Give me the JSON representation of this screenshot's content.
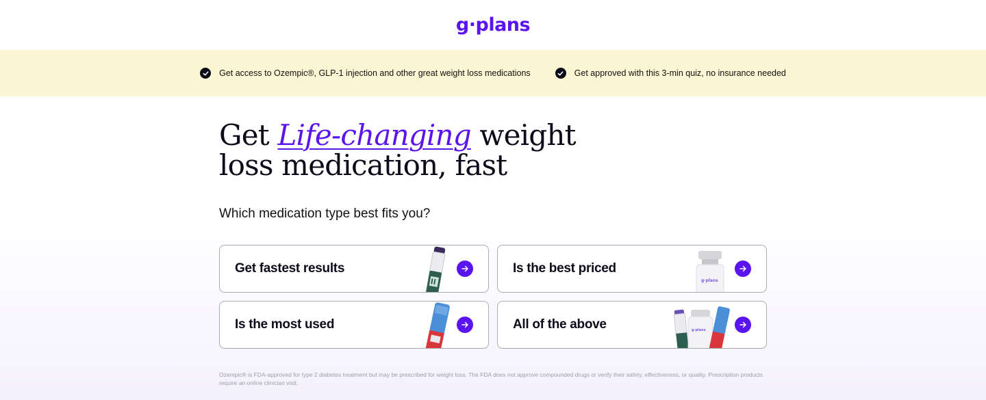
{
  "brand": {
    "logo_text": "g·plans",
    "accent_color": "#5a14f0"
  },
  "banner": {
    "items": [
      {
        "text": "Get access to Ozempic®, GLP-1 injection and other great weight loss medications",
        "icon": "check-circle-icon"
      },
      {
        "text": "Get approved with this 3-min quiz, no insurance needed",
        "icon": "check-circle-icon"
      }
    ]
  },
  "headline": {
    "prefix": "Get ",
    "accent": "Life-changing",
    "suffix": " weight loss medication, fast"
  },
  "question": "Which medication type best fits you?",
  "options": [
    {
      "label": "Get fastest results",
      "image": "injection-pen-image",
      "icon": "arrow-right-icon"
    },
    {
      "label": "Is the best priced",
      "image": "vial-image",
      "icon": "arrow-right-icon"
    },
    {
      "label": "Is the most used",
      "image": "blue-pen-image",
      "icon": "arrow-right-icon"
    },
    {
      "label": "All of the above",
      "image": "product-group-image",
      "icon": "arrow-right-icon"
    }
  ],
  "disclaimer": "Ozempic® is FDA-approved for type 2 diabetes treatment but may be prescribed for weight loss. The FDA does not approve compounded drugs or verify their safety, effectiveness, or quality. Prescription products require an online clinician visit."
}
